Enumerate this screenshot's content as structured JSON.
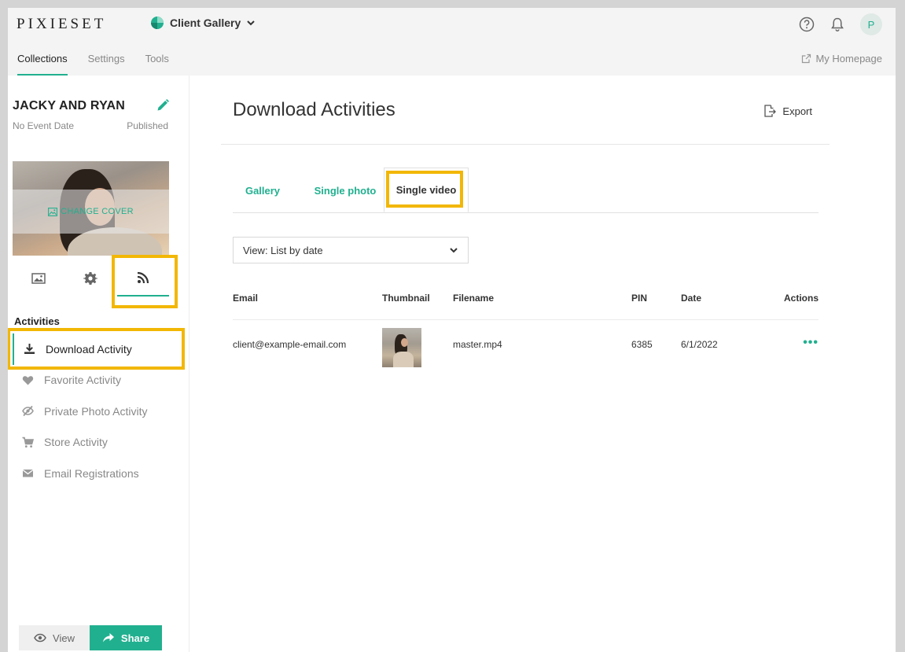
{
  "app": {
    "logo": "PIXIESET",
    "gallery_selector": "Client Gallery",
    "avatar_initial": "P"
  },
  "nav": {
    "tabs": [
      {
        "label": "Collections"
      },
      {
        "label": "Settings"
      },
      {
        "label": "Tools"
      }
    ],
    "homepage_link": "My Homepage"
  },
  "sidebar": {
    "collection_title": "JACKY AND RYAN",
    "event_date": "No Event Date",
    "status": "Published",
    "change_cover": "CHANGE COVER",
    "activities_heading": "Activities",
    "activities": [
      {
        "label": "Download Activity",
        "icon": "download-icon"
      },
      {
        "label": "Favorite Activity",
        "icon": "heart-icon"
      },
      {
        "label": "Private Photo Activity",
        "icon": "eye-slash-icon"
      },
      {
        "label": "Store Activity",
        "icon": "cart-icon"
      },
      {
        "label": "Email Registrations",
        "icon": "envelope-icon"
      }
    ],
    "view_button": "View",
    "share_button": "Share"
  },
  "main": {
    "title": "Download Activities",
    "export_label": "Export",
    "tabs": [
      {
        "label": "Gallery"
      },
      {
        "label": "Single photo"
      },
      {
        "label": "Single video"
      }
    ],
    "view_select": "View: List by date",
    "table": {
      "headers": [
        "Email",
        "Thumbnail",
        "Filename",
        "PIN",
        "Date",
        "Actions"
      ],
      "rows": [
        {
          "email": "client@example-email.com",
          "filename": "master.mp4",
          "pin": "6385",
          "date": "6/1/2022"
        }
      ]
    }
  },
  "colors": {
    "accent": "#21b08f",
    "highlight": "#f2b705"
  }
}
